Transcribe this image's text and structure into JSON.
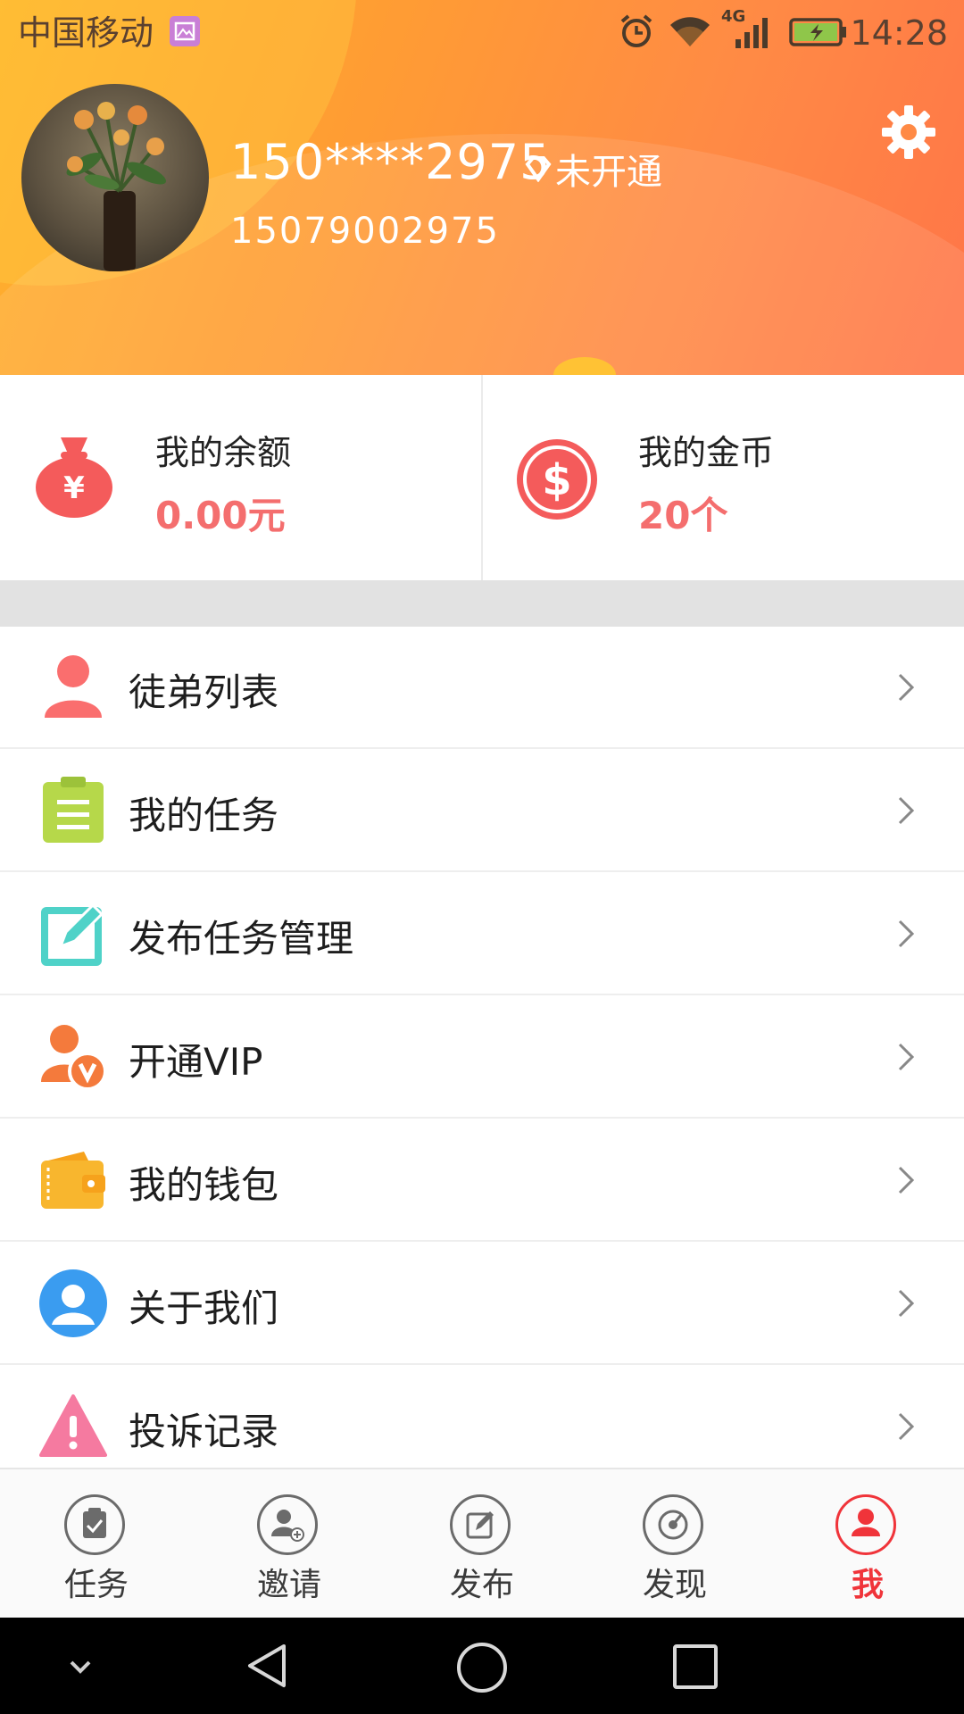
{
  "status_bar": {
    "carrier": "中国移动",
    "network": "4G",
    "time": "14:28"
  },
  "profile": {
    "username": "150****2975",
    "vip_status": "未开通",
    "phone": "15079002975"
  },
  "stats": {
    "balance": {
      "title": "我的余额",
      "value": "0.00元"
    },
    "coins": {
      "title": "我的金币",
      "value": "20个"
    }
  },
  "menu": {
    "items": [
      {
        "label": "徒弟列表",
        "icon": "person-icon",
        "color": "#fa6e6e"
      },
      {
        "label": "我的任务",
        "icon": "clipboard-icon",
        "color": "#b6d84a"
      },
      {
        "label": "发布任务管理",
        "icon": "edit-icon",
        "color": "#4fd2c8"
      },
      {
        "label": "开通VIP",
        "icon": "vip-user-icon",
        "color": "#f47a3c"
      },
      {
        "label": "我的钱包",
        "icon": "wallet-icon",
        "color": "#f8b62e"
      },
      {
        "label": "关于我们",
        "icon": "user-circle-icon",
        "color": "#3a9cf0"
      },
      {
        "label": "投诉记录",
        "icon": "warning-icon",
        "color": "#f57aa0"
      }
    ]
  },
  "bottom_nav": {
    "items": [
      {
        "label": "任务",
        "icon": "task-icon"
      },
      {
        "label": "邀请",
        "icon": "invite-icon"
      },
      {
        "label": "发布",
        "icon": "publish-icon"
      },
      {
        "label": "发现",
        "icon": "discover-icon"
      },
      {
        "label": "我",
        "icon": "me-icon",
        "active": true
      }
    ]
  },
  "colors": {
    "header_start": "#ffb22c",
    "header_end": "#ff7548",
    "accent_red": "#f0343a",
    "stat_value": "#f46e6e"
  }
}
